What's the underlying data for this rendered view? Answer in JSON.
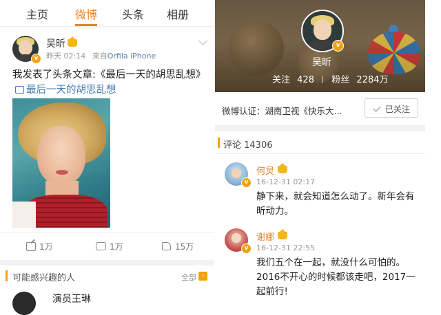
{
  "left": {
    "tabs": [
      {
        "label": "主页"
      },
      {
        "label": "微博"
      },
      {
        "label": "头条"
      },
      {
        "label": "相册"
      }
    ],
    "post": {
      "author": "吴昕",
      "time": "昨天 02:14",
      "source_prefix": "来自",
      "source": "Orfila iPhone",
      "text_main": "我发表了头条文章:《最后一天的胡思乱想》",
      "link_text": "最后一天的胡思乱想",
      "actions": {
        "share": "1万",
        "comment": "1万",
        "like": "15万"
      }
    },
    "interest": {
      "title": "可能感兴趣的人",
      "all_label": "全部",
      "first_name": "演员王琳"
    }
  },
  "right": {
    "profile": {
      "name": "吴昕",
      "follow_label": "关注",
      "follow_count": "428",
      "fans_label": "粉丝",
      "fans_count": "2284万"
    },
    "verify_text": "微博认证：湖南卫视《快乐大...",
    "followed_label": "已关注",
    "comments_title": "评论 14306",
    "comments": [
      {
        "name": "何炅",
        "time": "16-12-31 02:17",
        "text": "静下来，就会知道怎么动了。新年会有昕动力。"
      },
      {
        "name": "谢娜",
        "time": "16-12-31 22:55",
        "text": "我们五个在一起，就没什么可怕的。2016不开心的时候都该走吧，2017一起前行!"
      }
    ]
  },
  "colors": {
    "accent": "#e8832b",
    "link": "#4a7db3",
    "badge": "#f2a20c"
  }
}
